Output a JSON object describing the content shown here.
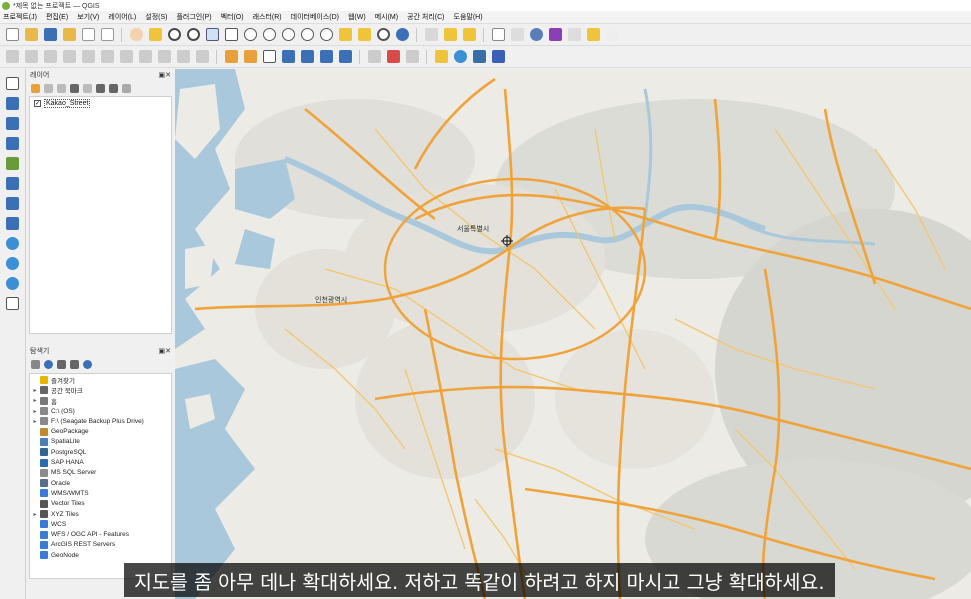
{
  "window": {
    "title": "*제목 없는 프로젝트 — QGIS"
  },
  "menu": [
    "프로젝트(J)",
    "편집(E)",
    "보기(V)",
    "레이어(L)",
    "설정(S)",
    "플러그인(P)",
    "벡터(O)",
    "래스터(R)",
    "데이터베이스(D)",
    "웹(W)",
    "메시(M)",
    "공간 처리(C)",
    "도움말(H)"
  ],
  "layers_panel": {
    "title": "레이어",
    "layers": [
      {
        "name": "Kakao_Street",
        "checked": true
      }
    ]
  },
  "browser_panel": {
    "title": "탐색기",
    "items": [
      {
        "label": "즐겨찾기",
        "expandable": false,
        "icon": "star-icon",
        "color": "#e8b800"
      },
      {
        "label": "공간 북마크",
        "expandable": true,
        "icon": "bookmark-icon",
        "color": "#666666"
      },
      {
        "label": "홈",
        "expandable": true,
        "icon": "home-folder-icon",
        "color": "#777777"
      },
      {
        "label": "C:\\ (OS)",
        "expandable": true,
        "icon": "drive-icon",
        "color": "#888888"
      },
      {
        "label": "F:\\ (Seagate Backup Plus Drive)",
        "expandable": true,
        "icon": "drive-icon",
        "color": "#888888"
      },
      {
        "label": "GeoPackage",
        "expandable": false,
        "icon": "geopackage-icon",
        "color": "#c08a2e"
      },
      {
        "label": "SpatiaLite",
        "expandable": false,
        "icon": "spatialite-icon",
        "color": "#4a7fb8"
      },
      {
        "label": "PostgreSQL",
        "expandable": false,
        "icon": "postgresql-icon",
        "color": "#336791"
      },
      {
        "label": "SAP HANA",
        "expandable": false,
        "icon": "sap-hana-icon",
        "color": "#2b6cb0"
      },
      {
        "label": "MS SQL Server",
        "expandable": false,
        "icon": "mssql-icon",
        "color": "#8c8c8c"
      },
      {
        "label": "Oracle",
        "expandable": false,
        "icon": "oracle-icon",
        "color": "#5a6f8c"
      },
      {
        "label": "WMS/WMTS",
        "expandable": false,
        "icon": "wms-icon",
        "color": "#3a7bd5"
      },
      {
        "label": "Vector Tiles",
        "expandable": false,
        "icon": "vector-tiles-icon",
        "color": "#555555"
      },
      {
        "label": "XYZ Tiles",
        "expandable": true,
        "icon": "xyz-tiles-icon",
        "color": "#555555"
      },
      {
        "label": "WCS",
        "expandable": false,
        "icon": "wcs-icon",
        "color": "#3a7bd5"
      },
      {
        "label": "WFS / OGC API - Features",
        "expandable": false,
        "icon": "wfs-icon",
        "color": "#3a7bd5"
      },
      {
        "label": "ArcGIS REST Servers",
        "expandable": false,
        "icon": "arcgis-icon",
        "color": "#3a7bd5"
      },
      {
        "label": "GeoNode",
        "expandable": false,
        "icon": "geonode-icon",
        "color": "#3a7bd5"
      }
    ]
  },
  "map": {
    "place_labels": [
      "서울특별시",
      "인천광역시"
    ],
    "colors": {
      "land": "#ecebe6",
      "water": "#aac8dc",
      "major_road": "#f0a33a",
      "minor_road": "#f3c66d",
      "urban": "#dddad2",
      "hills": "#d4d4cf"
    }
  },
  "subtitle": "지도를 좀 아무 데나 확대하세요. 저하고 똑같이 하려고 하지 마시고 그냥 확대하세요."
}
